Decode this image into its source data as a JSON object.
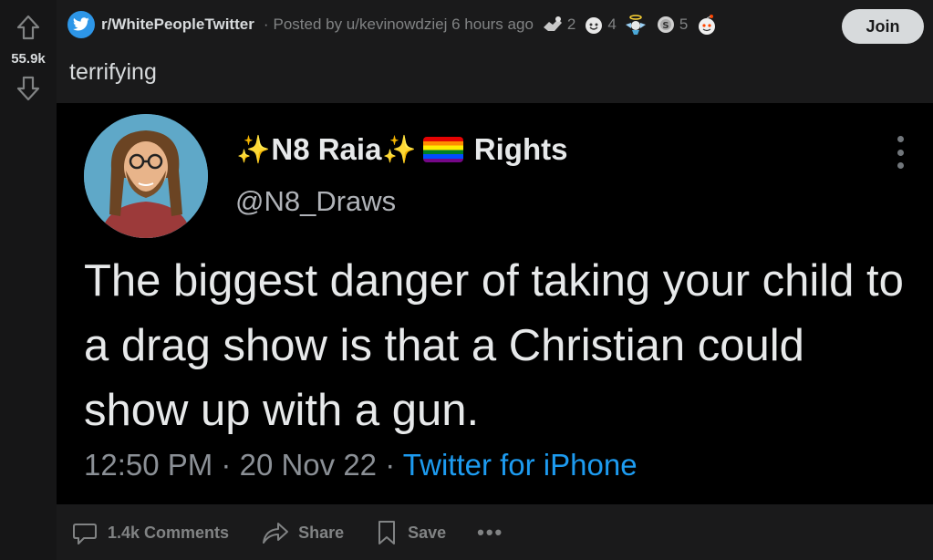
{
  "vote": {
    "score": "55.9k"
  },
  "header": {
    "subreddit": "r/WhitePeopleTwitter",
    "separator": "·",
    "posted_by": "Posted by u/kevinowdziej",
    "time": "6 hours ago",
    "awards": [
      {
        "icon": "helpful-award-icon",
        "count": "2"
      },
      {
        "icon": "wholesome-award-icon",
        "count": "4"
      },
      {
        "icon": "angel-award-icon",
        "count": ""
      },
      {
        "icon": "silver-award-icon",
        "count": "5"
      },
      {
        "icon": "snoo-award-icon",
        "count": ""
      }
    ],
    "join_label": "Join"
  },
  "post": {
    "title": "terrifying"
  },
  "tweet": {
    "name_part1": "N8 Raia",
    "name_part2": "Rights",
    "handle": "@N8_Draws",
    "text": "The biggest danger of taking your child to a drag show is that a Christian could show up with a gun.",
    "time": "12:50 PM",
    "sep1": "·",
    "date": "20 Nov 22",
    "sep2": "·",
    "source": "Twitter for iPhone"
  },
  "actions": {
    "comments": "1.4k Comments",
    "share": "Share",
    "save": "Save",
    "more": "•••"
  },
  "colors": {
    "background": "#1a1a1b",
    "text": "#d7dadc",
    "muted": "#818384",
    "twitter_blue": "#1d9bf0",
    "subreddit_icon": "#2d96e8"
  }
}
